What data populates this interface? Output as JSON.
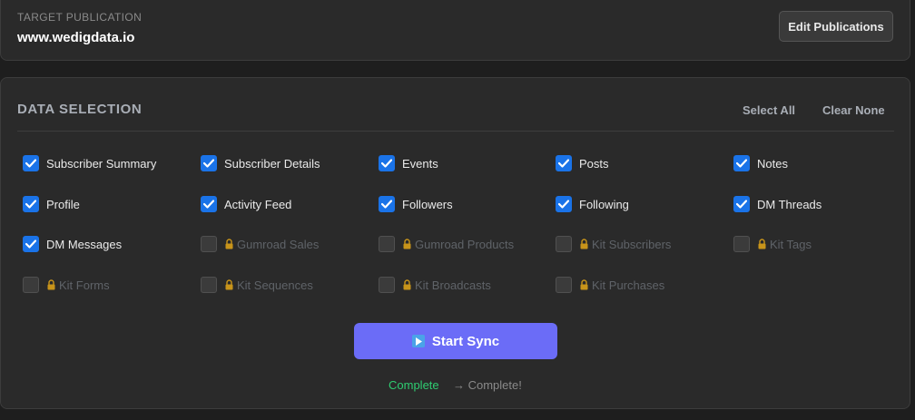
{
  "target": {
    "label": "TARGET PUBLICATION",
    "value": "www.wedigdata.io",
    "edit_button": "Edit Publications"
  },
  "selection": {
    "title": "DATA SELECTION",
    "select_all": "Select All",
    "clear_none": "Clear None",
    "options": [
      {
        "label": "Subscriber Summary",
        "checked": true,
        "locked": false
      },
      {
        "label": "Subscriber Details",
        "checked": true,
        "locked": false
      },
      {
        "label": "Events",
        "checked": true,
        "locked": false
      },
      {
        "label": "Posts",
        "checked": true,
        "locked": false
      },
      {
        "label": "Notes",
        "checked": true,
        "locked": false
      },
      {
        "label": "Profile",
        "checked": true,
        "locked": false
      },
      {
        "label": "Activity Feed",
        "checked": true,
        "locked": false
      },
      {
        "label": "Followers",
        "checked": true,
        "locked": false
      },
      {
        "label": "Following",
        "checked": true,
        "locked": false
      },
      {
        "label": "DM Threads",
        "checked": true,
        "locked": false
      },
      {
        "label": "DM Messages",
        "checked": true,
        "locked": false
      },
      {
        "label": "Gumroad Sales",
        "checked": false,
        "locked": true
      },
      {
        "label": "Gumroad Products",
        "checked": false,
        "locked": true
      },
      {
        "label": "Kit Subscribers",
        "checked": false,
        "locked": true
      },
      {
        "label": "Kit Tags",
        "checked": false,
        "locked": true
      },
      {
        "label": "Kit Forms",
        "checked": false,
        "locked": true
      },
      {
        "label": "Kit Sequences",
        "checked": false,
        "locked": true
      },
      {
        "label": "Kit Broadcasts",
        "checked": false,
        "locked": true
      },
      {
        "label": "Kit Purchases",
        "checked": false,
        "locked": true
      }
    ]
  },
  "sync": {
    "button_label": "Start Sync",
    "button_icon": "play-icon",
    "status_left": "Complete",
    "status_right": "→ Complete!"
  },
  "colors": {
    "accent": "#6b6cf7",
    "checkbox": "#1a73e8",
    "success": "#2ecc71",
    "lock": "#c8941a"
  }
}
